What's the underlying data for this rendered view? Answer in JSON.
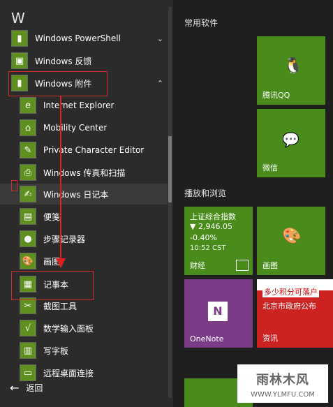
{
  "left_menu": {
    "letter": "W",
    "items": [
      {
        "label": "Windows PowerShell",
        "type": "folder",
        "expanded": false
      },
      {
        "label": "Windows 反馈",
        "type": "app"
      },
      {
        "label": "Windows 附件",
        "type": "folder",
        "expanded": true
      },
      {
        "label": "Internet Explorer",
        "type": "app"
      },
      {
        "label": "Mobility Center",
        "type": "app"
      },
      {
        "label": "Private Character Editor",
        "type": "app"
      },
      {
        "label": "Windows 传真和扫描",
        "type": "app"
      },
      {
        "label": "Windows 日记本",
        "type": "app"
      },
      {
        "label": "便笺",
        "type": "app"
      },
      {
        "label": "步骤记录器",
        "type": "app"
      },
      {
        "label": "画图",
        "type": "app"
      },
      {
        "label": "记事本",
        "type": "app"
      },
      {
        "label": "截图工具",
        "type": "app"
      },
      {
        "label": "数学输入面板",
        "type": "app"
      },
      {
        "label": "写字板",
        "type": "app"
      },
      {
        "label": "远程桌面连接",
        "type": "app"
      }
    ],
    "back_label": "返回"
  },
  "right_panel": {
    "section_common": "常用软件",
    "section_play": "播放和浏览",
    "tiles": {
      "qq": "腾讯QQ",
      "wechat": "微信",
      "finance": {
        "line1": "上证综合指数",
        "line2": "▼ 2,946.05",
        "line3": "-0.40%",
        "line4": "10:52 CST",
        "label": "财经"
      },
      "paint": "画图",
      "onenote": "OneNote",
      "news": {
        "headline1": "多少积分可落户",
        "headline2": "北京市政府公布",
        "label": "资讯"
      }
    }
  },
  "watermark": {
    "title": "雨林木风",
    "url": "WWW.YLMFU.COM"
  },
  "colors": {
    "tile_green": "#4a8c1c",
    "tile_purple": "#7a3c86",
    "highlight_red": "#d32b2b"
  }
}
